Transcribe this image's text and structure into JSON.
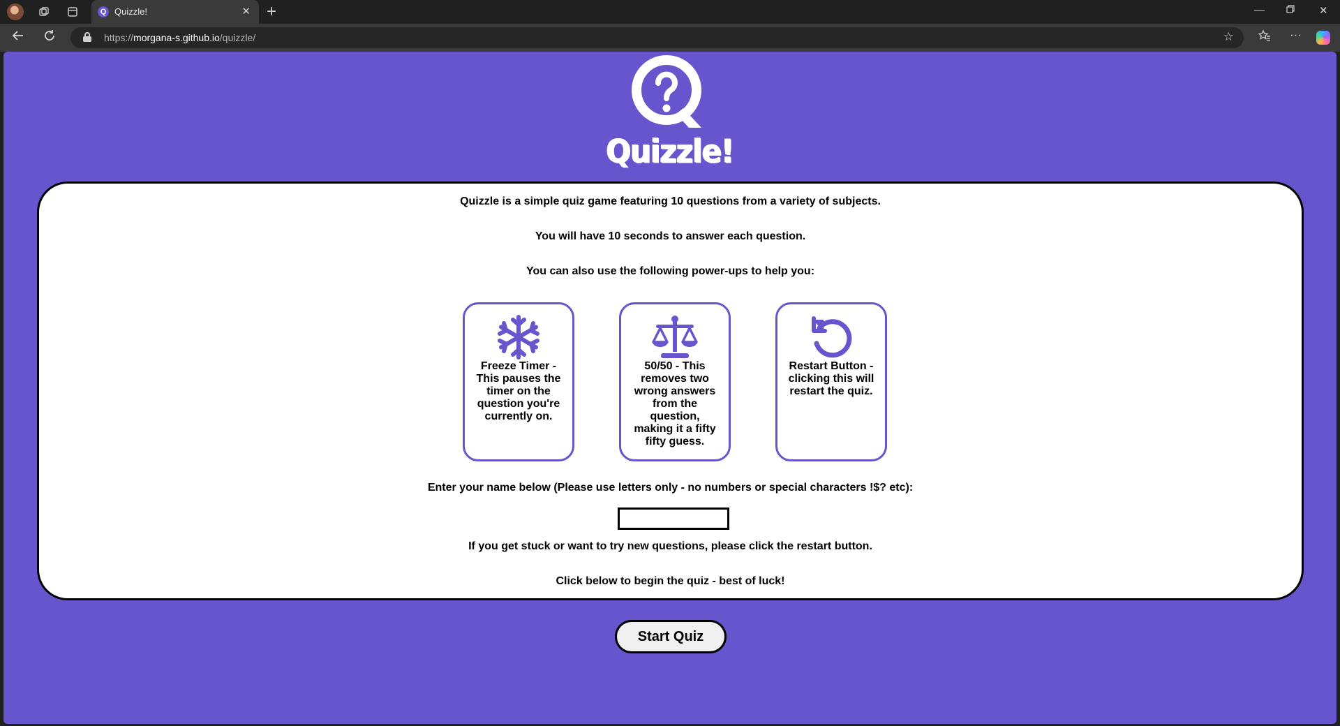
{
  "browser": {
    "tab_title": "Quizzle!",
    "tab_favicon_letter": "Q",
    "url_scheme": "https://",
    "url_host": "morgana-s.github.io",
    "url_path": "/quizzle/",
    "icons": [
      "profile-avatar",
      "workspaces-icon",
      "tab-actions-icon",
      "close-icon",
      "plus-icon",
      "minimize-icon",
      "restore-icon",
      "window-close-icon",
      "back-icon",
      "refresh-icon",
      "lock-icon",
      "star-icon",
      "favorites-icon",
      "more-icon",
      "copilot-icon"
    ]
  },
  "page": {
    "background_color": "#6655cc",
    "brand": "Quizzle!",
    "intro": "Quizzle is a simple quiz game featuring 10 questions from a variety of subjects.",
    "timer_note": "You will have 10 seconds to answer each question.",
    "powerups_intro": "You can also use the following power-ups to help you:",
    "powerups": [
      {
        "icon": "snowflake-icon",
        "text": "Freeze Timer - This pauses the timer on the question you're currently on."
      },
      {
        "icon": "scale-icon",
        "text": "50/50 - This removes two wrong answers from the question, making it a fifty fifty guess."
      },
      {
        "icon": "restart-icon",
        "text": "Restart Button - clicking this will restart the quiz."
      }
    ],
    "name_prompt": "Enter your name below (Please use letters only - no numbers or special characters !$? etc):",
    "name_value": "",
    "stuck_note": "If you get stuck or want to try new questions, please click the restart button.",
    "begin_note": "Click below to begin the quiz - best of luck!",
    "start_label": "Start Quiz"
  }
}
